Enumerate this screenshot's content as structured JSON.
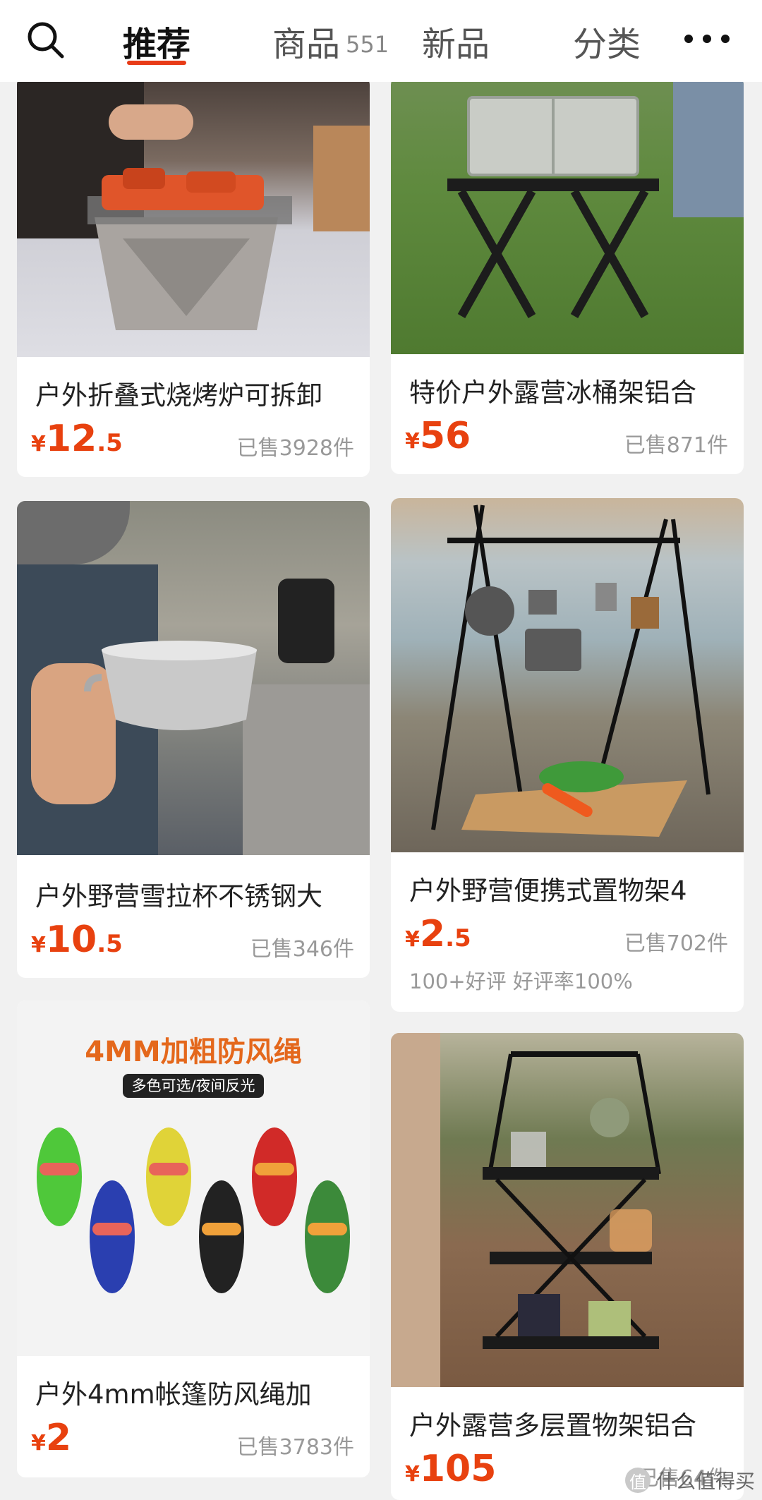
{
  "tabs": [
    {
      "label": "推荐",
      "count": "",
      "active": true
    },
    {
      "label": "商品",
      "count": "551",
      "active": false
    },
    {
      "label": "新品",
      "count": "",
      "active": false
    },
    {
      "label": "分类",
      "count": "",
      "active": false
    }
  ],
  "icons": {
    "search": "search-icon",
    "more": "more-dots-icon"
  },
  "colors": {
    "accent": "#e83b17",
    "price": "#e8410f"
  },
  "products": [
    {
      "title": "户外折叠式烧烤炉可拆卸",
      "currency": "¥",
      "price_int": "12",
      "price_dec": ".5",
      "sold": "已售3928件"
    },
    {
      "title": "特价户外露营冰桶架铝合",
      "currency": "¥",
      "price_int": "56",
      "price_dec": "",
      "sold": "已售871件"
    },
    {
      "title": "户外野营雪拉杯不锈钢大",
      "currency": "¥",
      "price_int": "10",
      "price_dec": ".5",
      "sold": "已售346件"
    },
    {
      "title": "户外野营便携式置物架4",
      "currency": "¥",
      "price_int": "2",
      "price_dec": ".5",
      "sold": "已售702件",
      "extra": "100+好评   好评率100%"
    },
    {
      "title": "户外4mm帐篷防风绳加",
      "currency": "¥",
      "price_int": "2",
      "price_dec": "",
      "sold": "已售3783件",
      "banner_title": "4MM加粗防风绳",
      "banner_sub": "多色可选/夜间反光"
    },
    {
      "title": "户外露营多层置物架铝合",
      "currency": "¥",
      "price_int": "105",
      "price_dec": "",
      "sold": "已售64件"
    }
  ],
  "watermark": {
    "badge": "值",
    "text": "什么值得买"
  }
}
